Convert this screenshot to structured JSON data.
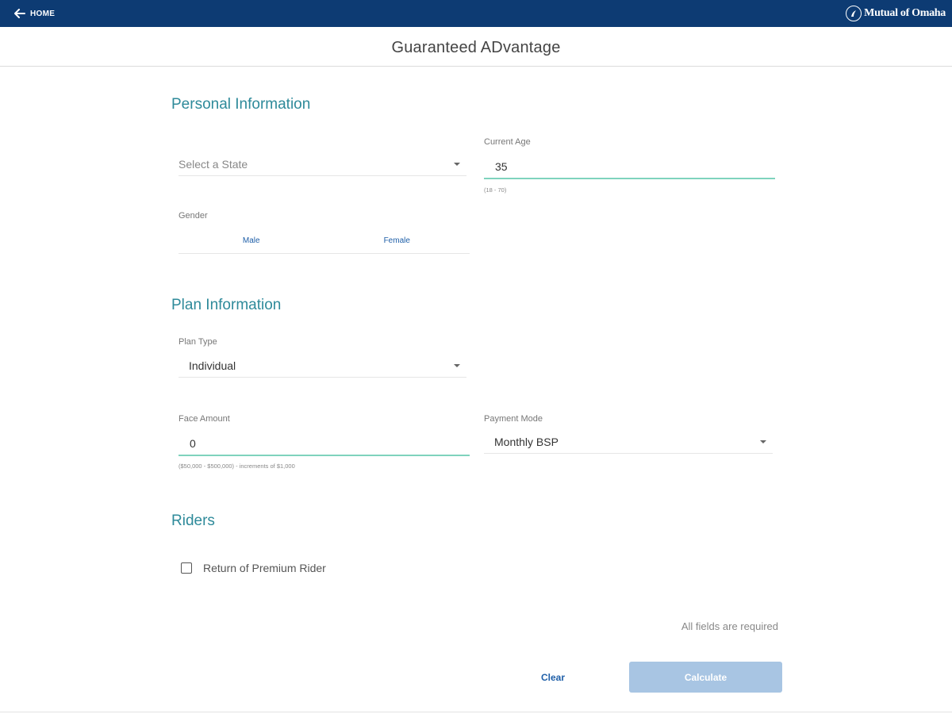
{
  "header": {
    "home_label": "HOME",
    "brand_name": "Mutual of Omaha"
  },
  "page_title": "Guaranteed ADvantage",
  "personal": {
    "heading": "Personal Information",
    "state": {
      "placeholder": "Select a State"
    },
    "age": {
      "label": "Current Age",
      "value": "35",
      "helper": "(18 - 70)"
    },
    "gender": {
      "label": "Gender",
      "options": [
        "Male",
        "Female"
      ]
    }
  },
  "plan": {
    "heading": "Plan Information",
    "plan_type": {
      "label": "Plan Type",
      "value": "Individual"
    },
    "face_amount": {
      "label": "Face Amount",
      "value": "0",
      "helper": "($50,000 - $500,000) - increments of $1,000"
    },
    "payment_mode": {
      "label": "Payment Mode",
      "value": "Monthly BSP"
    }
  },
  "riders": {
    "heading": "Riders",
    "return_of_premium": {
      "label": "Return of Premium Rider",
      "checked": false
    }
  },
  "footer": {
    "required_note": "All fields are required",
    "clear_label": "Clear",
    "calculate_label": "Calculate"
  },
  "colors": {
    "header_bg": "#0d3b73",
    "section_heading": "#2e8a9a",
    "accent_underline": "#7fd3bd",
    "link_blue": "#1f5fa8",
    "disabled_button": "#a8c5e3"
  },
  "icons": {
    "back": "arrow-left-icon",
    "brand": "brand-logo-icon",
    "dropdown": "caret-down-icon"
  }
}
